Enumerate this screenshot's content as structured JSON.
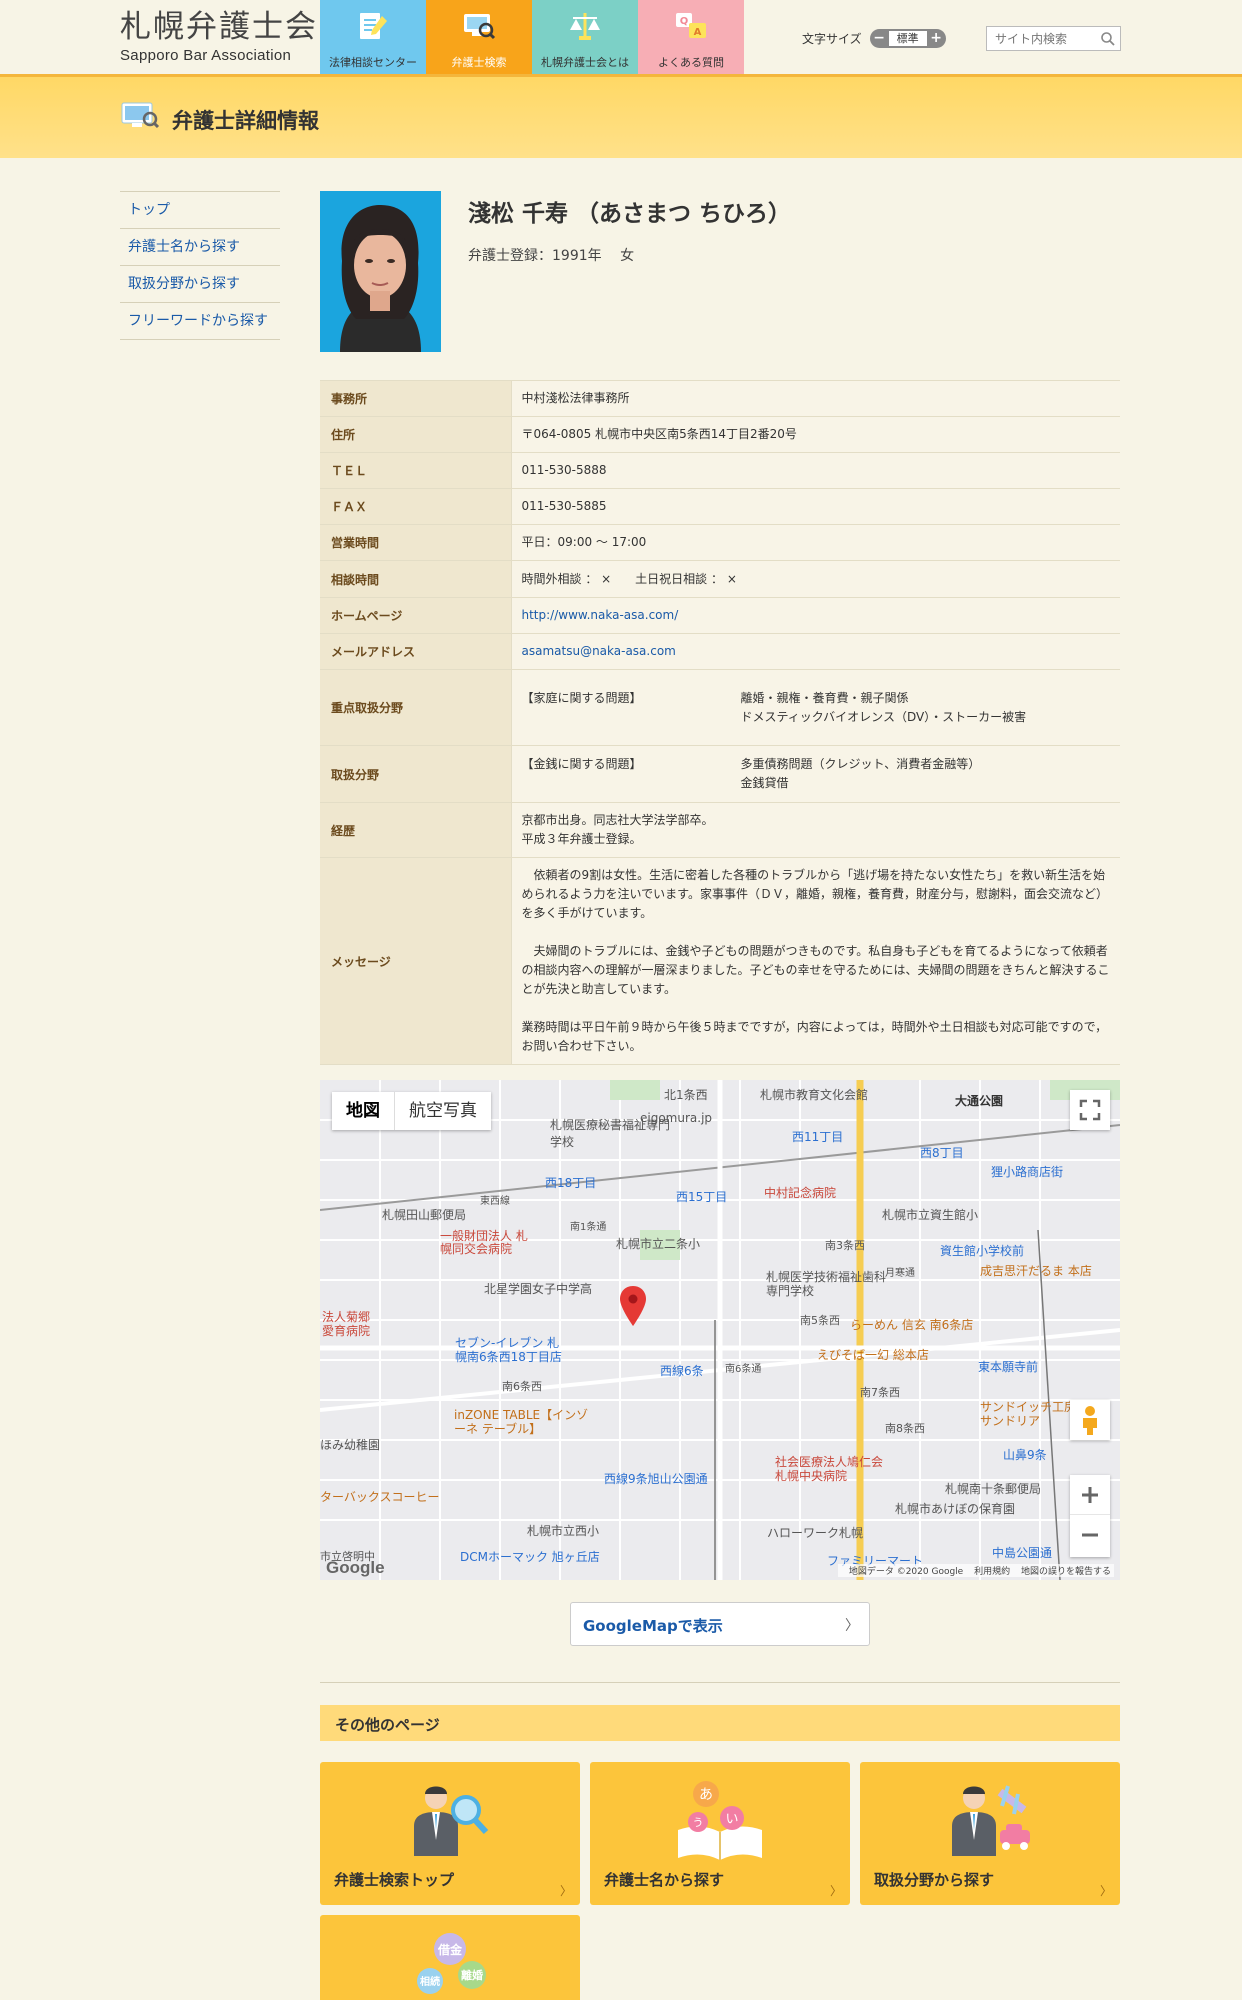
{
  "header": {
    "logo_jp": "札幌弁護士会",
    "logo_en": "Sapporo Bar Association",
    "nav": [
      {
        "label": "法律相談センター",
        "color": "#6fc8ee"
      },
      {
        "label": "弁護士検索",
        "color": "#f8a41a"
      },
      {
        "label": "札幌弁護士会とは",
        "color": "#7cd0c6"
      },
      {
        "label": "よくある質問",
        "color": "#f7aeb5"
      }
    ],
    "fontsize_label": "文字サイズ",
    "fontsize_minus": "−",
    "fontsize_value": "標準",
    "fontsize_plus": "+",
    "search_placeholder": "サイト内検索"
  },
  "page_title": "弁護士詳細情報",
  "sidebar": [
    "トップ",
    "弁護士名から探す",
    "取扱分野から探す",
    "フリーワードから探す"
  ],
  "profile": {
    "name": "淺松 千寿 （あさまつ ちひろ）",
    "registration": "弁護士登録：1991年　 女"
  },
  "details": {
    "office_label": "事務所",
    "office": "中村淺松法律事務所",
    "address_label": "住所",
    "address": "〒064-0805 札幌市中央区南5条西14丁目2番20号",
    "tel_label": "ＴＥＬ",
    "tel": "011-530-5888",
    "fax_label": "ＦＡＸ",
    "fax": "011-530-5885",
    "hours_label": "営業時間",
    "hours": "平日：09:00 ～ 17:00",
    "consult_label": "相談時間",
    "consult": "時間外相談 ： ×　　土日祝日相談 ： ×",
    "homepage_label": "ホームページ",
    "homepage": "http://www.naka-asa.com/",
    "email_label": "メールアドレス",
    "email": "asamatsu@naka-asa.com",
    "focus_label": "重点取扱分野",
    "focus_category": "【家庭に関する問題】",
    "focus_items_1": "離婚・親権・養育費・親子関係",
    "focus_items_2": "ドメスティックバイオレンス（DV）・ストーカー被害",
    "areas_label": "取扱分野",
    "areas_category": "【金銭に関する問題】",
    "areas_items_1": "多重債務問題（クレジット、消費者金融等）",
    "areas_items_2": "金銭貸借",
    "career_label": "経歴",
    "career_1": "京都市出身。同志社大学法学部卒。",
    "career_2": "平成３年弁護士登録。",
    "message_label": "メッセージ",
    "message_1": "　依頼者の9割は女性。生活に密着した各種のトラブルから「逃げ場を持たない女性たち」を救い新生活を始められるよう力を注いでいます。家事事件（ＤＶ，離婚，親権，養育費，財産分与，慰謝料，面会交流など）を多く手がけています。",
    "message_2": "　夫婦間のトラブルには、金銭や子どもの問題がつきものです。私自身も子どもを育てるようになって依頼者の相談内容への理解が一層深まりました。子どもの幸せを守るためには、夫婦間の問題をきちんと解決することが先決と助言しています。",
    "message_3": "業務時間は平日午前９時から午後５時までですが，内容によっては，時間外や土日相談も対応可能ですので，お問い合わせ下さい。"
  },
  "map": {
    "tab_map": "地図",
    "tab_aerial": "航空写真",
    "footer": [
      "地図データ ©2020 Google",
      "利用規約",
      "地図の誤りを報告する"
    ],
    "google": "Google",
    "labels": {
      "l1": "札幌市教育文化会館",
      "l2": "大通公園",
      "l3": "北1条西",
      "l4": "札幌医療秘書福祉専門学校",
      "l5": "eigomura.jp",
      "l6": "西11丁目",
      "l7": "西8丁目",
      "l8": "狸小路商店街",
      "l9": "西18丁目",
      "l10": "西15丁目",
      "l11": "中村記念病院",
      "l12": "札幌市立資生館小",
      "l13": "札幌田山郵便局",
      "l14": "東西線",
      "l15": "一般財団法人 札幌同交会病院",
      "l16": "南1条通",
      "l17": "札幌市立二条小",
      "l18": "南3条西",
      "l19": "資生館小学校前",
      "l20": "成吉思汗だるま 本店",
      "l21": "北星学園女子中学高",
      "l22": "札幌医学技術福祉歯科専門学校",
      "l23": "月寒通",
      "l24": "南5条西",
      "l25": "らーめん 信玄 南6条店",
      "l26": "法人菊郷 愛育病院",
      "l27": "セブン-イレブン 札幌南6条西18丁目店",
      "l28": "西線6条",
      "l29": "南6条通",
      "l30": "えびそば一幻 総本店",
      "l31": "東本願寺前",
      "l32": "南6条西",
      "l33": "inZONE TABLE【インゾーネ テーブル】",
      "l34": "南7条西",
      "l35": "サンドイッチ工房 サンドリア",
      "l36": "南8条西",
      "l37": "山鼻9条",
      "l38": "ほみ幼稚園",
      "l39": "西線9条旭山公園通",
      "l40": "社会医療法人鳩仁会 札幌中央病院",
      "l41": "ターバックスコーヒー",
      "l42": "札幌南十条郵便局",
      "l43": "札幌市あけぼの保育園",
      "l44": "札幌市立西小",
      "l45": "ハローワーク札幌",
      "l46": "DCMホーマック 旭ヶ丘店",
      "l47": "市立啓明中",
      "l48": "ファミリーマート",
      "l49": "中島公園通"
    }
  },
  "gm_button": "GoogleMapで表示",
  "gm_chevron": "〉",
  "other_pages_title": "その他のページ",
  "cards": [
    {
      "label": "弁護士検索トップ"
    },
    {
      "label": "弁護士名から探す"
    },
    {
      "label": "取扱分野から探す"
    },
    {
      "label": ""
    }
  ],
  "card_glyphs": {
    "a": "あ",
    "i": "い",
    "u": "う",
    "debt": "借金",
    "divorce": "離婚",
    "inherit": "相続"
  },
  "colors": {
    "accent": "#f8a41a",
    "title_band": "#ffd865",
    "card": "#fcc53b",
    "link": "#1a5aa8",
    "map_pin": "#e53935"
  }
}
